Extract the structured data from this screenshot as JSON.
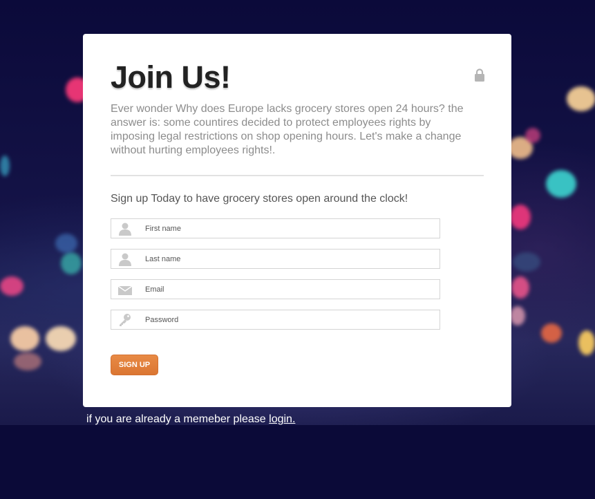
{
  "signup_card": {
    "title": "Join Us!",
    "intro": "Ever wonder Why does Europe lacks grocery stores open 24 hours? the answer is: some countires decided to protect employees rights by imposing legal restrictions on shop opening hours. Let's make a change without hurting employees rights!.",
    "subhead": "Sign up Today to have grocery stores open around the clock!",
    "lock_icon": "lock-icon",
    "fields": [
      {
        "placeholder": "First name",
        "icon": "user-icon",
        "type": "text"
      },
      {
        "placeholder": "Last name",
        "icon": "user-icon",
        "type": "text"
      },
      {
        "placeholder": "Email",
        "icon": "envelope-icon",
        "type": "email"
      },
      {
        "placeholder": "Password",
        "icon": "key-icon",
        "type": "password"
      }
    ],
    "submit_label": "Sign Up"
  },
  "footer": {
    "prefix": "if you are already a memeber please ",
    "login_link": "login."
  },
  "colors": {
    "page_background": "#0b0a38",
    "card_background": "#ffffff",
    "accent_orange": "#e07d3a",
    "intro_text": "#8c8c8c",
    "title_text": "#222222"
  }
}
